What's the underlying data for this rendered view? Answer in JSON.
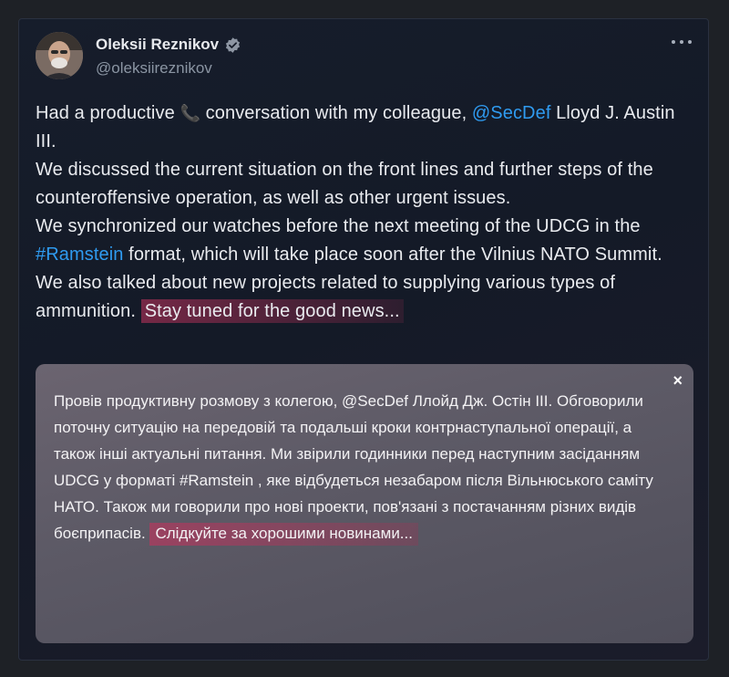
{
  "author": {
    "name": "Oleksii Reznikov",
    "handle": "@oleksiireznikov",
    "verified": true,
    "avatar_icon": "avatar"
  },
  "tweet": {
    "p1_start": "Had a productive",
    "p1_after_icon": " conversation with my colleague, ",
    "p1_mention": "@SecDef",
    "p1_end": " Lloyd J. Austin III.",
    "p2": "We discussed the current situation on the front lines and further steps of the counteroffensive operation, as well as other urgent issues.",
    "p3_start": "We synchronized our watches before the next meeting of the UDCG in the ",
    "p3_hashtag": "#Ramstein",
    "p3_end": " format, which will take place soon after the Vilnius NATO Summit.",
    "p4_start": "We also talked about new projects related to supplying various types of ammunition. ",
    "p4_highlight": "Stay tuned for the good news..."
  },
  "translation": {
    "text": "Провів продуктивну розмову з колегою, @SecDef Ллойд Дж. Остін III. Обговорили поточну ситуацію на передовій та подальші кроки контрнаступальної операції, а також інші актуальні питання. Ми звірили годинники перед наступним засіданням UDCG у форматі #Ramstein , яке відбудеться незабаром після Вільнюського саміту НАТО. Також ми говорили про нові проекти, пов'язані з постачанням різних видів боєприпасів. ",
    "highlight": "Слідкуйте за хорошими новинами...",
    "close_label": "×"
  },
  "colors": {
    "link": "#2f9bf0",
    "verified_badge": "#8e96a3"
  }
}
